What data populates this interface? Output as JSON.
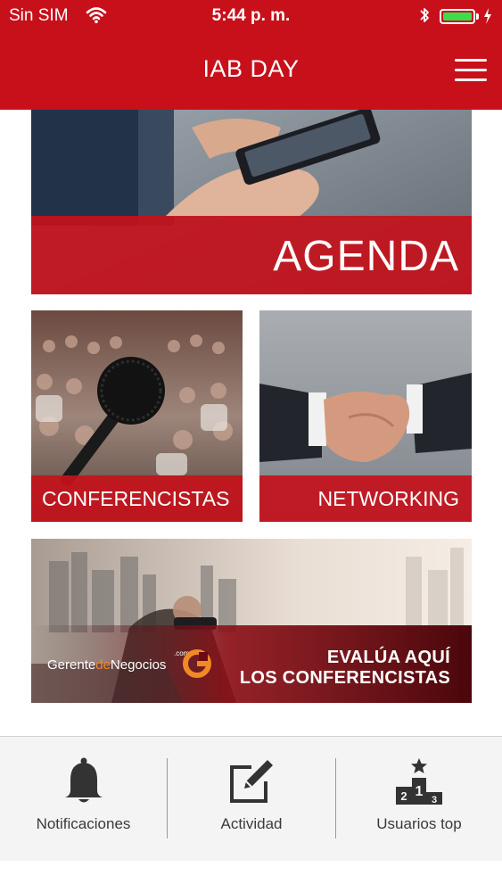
{
  "status_bar": {
    "carrier": "Sin SIM",
    "time": "5:44 p. m.",
    "battery_level": 1.0,
    "battery_color": "#3ddc4a"
  },
  "header": {
    "title": "IAB DAY",
    "menu_icon": "hamburger-menu-icon",
    "background": "#c8101b"
  },
  "tiles": {
    "agenda": {
      "label": "AGENDA"
    },
    "conferencistas": {
      "label": "CONFERENCISTAS"
    },
    "networking": {
      "label": "NETWORKING"
    },
    "evalua": {
      "line1": "EVALÚA AQUÍ",
      "line2": "LOS CONFERENCISTAS",
      "brand_prefix": "Gerente",
      "brand_mid": "de",
      "brand_suffix": "Negocios",
      "brand_com": ".com"
    }
  },
  "tabbar": {
    "items": [
      {
        "label": "Notificaciones",
        "icon": "bell-icon"
      },
      {
        "label": "Actividad",
        "icon": "edit-icon"
      },
      {
        "label": "Usuarios top",
        "icon": "podium-icon"
      }
    ]
  },
  "accent_color": "#c4121c"
}
